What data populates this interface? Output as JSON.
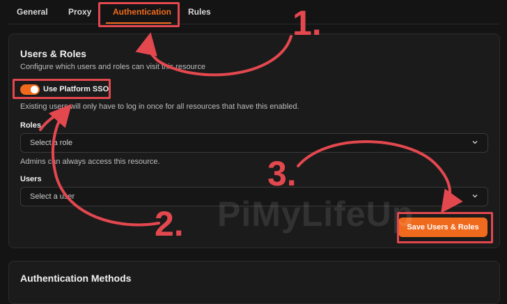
{
  "tabs": [
    {
      "label": "General"
    },
    {
      "label": "Proxy"
    },
    {
      "label": "Authentication"
    },
    {
      "label": "Rules"
    }
  ],
  "users_roles": {
    "title": "Users & Roles",
    "subtitle": "Configure which users and roles can visit this resource",
    "sso": {
      "label": "Use Platform SSO",
      "enabled": true,
      "help": "Existing users will only have to log in once for all resources that have this enabled."
    },
    "roles": {
      "label": "Roles",
      "placeholder": "Select a role",
      "help": "Admins can always access this resource."
    },
    "users": {
      "label": "Users",
      "placeholder": "Select a user"
    },
    "save_label": "Save Users & Roles"
  },
  "auth_methods": {
    "title": "Authentication Methods"
  },
  "annotations": {
    "step1": "1.",
    "step2": "2.",
    "step3": "3."
  },
  "watermark": "PiMyLifeUp",
  "colors": {
    "accent": "#f06a1d",
    "annotation": "#e4484f",
    "background": "#141414"
  }
}
